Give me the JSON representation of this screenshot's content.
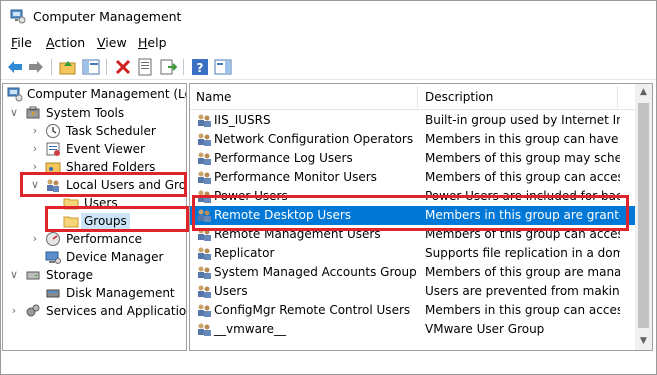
{
  "window": {
    "title": "Computer Management"
  },
  "menu": {
    "file": "File",
    "file_key": "F",
    "file_rest": "ile",
    "action_key": "A",
    "action_rest": "ction",
    "view_key": "V",
    "view_rest": "iew",
    "help_key": "H",
    "help_rest": "elp"
  },
  "tree": {
    "items": [
      {
        "label": "Computer Management (Loca"
      },
      {
        "label": "System Tools"
      },
      {
        "label": "Task Scheduler"
      },
      {
        "label": "Event Viewer"
      },
      {
        "label": "Shared Folders"
      },
      {
        "label": "Local Users and Group"
      },
      {
        "label": "Users"
      },
      {
        "label": "Groups"
      },
      {
        "label": "Performance"
      },
      {
        "label": "Device Manager"
      },
      {
        "label": "Storage"
      },
      {
        "label": "Disk Management"
      },
      {
        "label": "Services and Applications"
      }
    ]
  },
  "list": {
    "columns": {
      "name": "Name",
      "description": "Description"
    },
    "rows": [
      {
        "name": "IIS_IUSRS",
        "description": "Built-in group used by Internet Inf..."
      },
      {
        "name": "Network Configuration Operators",
        "description": "Members in this group can have s..."
      },
      {
        "name": "Performance Log Users",
        "description": "Members of this group may sche..."
      },
      {
        "name": "Performance Monitor Users",
        "description": "Members of this group can acces..."
      },
      {
        "name": "Power Users",
        "description": "Power Users are included for back..."
      },
      {
        "name": "Remote Desktop Users",
        "description": "Members in this group are grante..."
      },
      {
        "name": "Remote Management Users",
        "description": "Members of this group can acces..."
      },
      {
        "name": "Replicator",
        "description": "Supports file replication in a dom..."
      },
      {
        "name": "System Managed Accounts Group",
        "description": "Members of this group are mana..."
      },
      {
        "name": "Users",
        "description": "Users are prevented from making ..."
      },
      {
        "name": "ConfigMgr Remote Control Users",
        "description": "Members in this group can acces..."
      },
      {
        "name": "__vmware__",
        "description": "VMware User Group"
      }
    ]
  },
  "colors": {
    "highlight": "#e0242c",
    "selection": "#0078d7",
    "tree_selection": "#cce4f7"
  }
}
